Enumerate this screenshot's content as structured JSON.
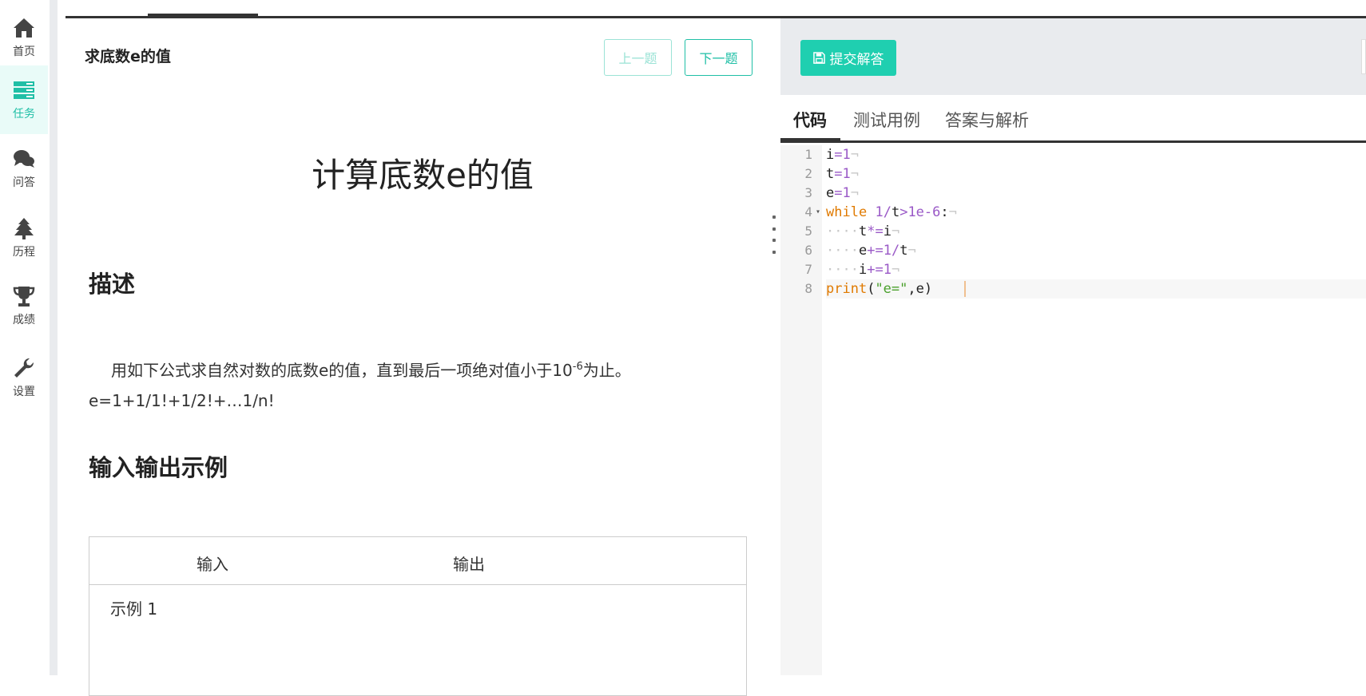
{
  "nav": {
    "items": [
      {
        "label": "首页",
        "icon": "home-icon"
      },
      {
        "label": "任务",
        "icon": "tasks-icon",
        "active": true
      },
      {
        "label": "问答",
        "icon": "chat-icon"
      },
      {
        "label": "历程",
        "icon": "tree-icon"
      },
      {
        "label": "成绩",
        "icon": "trophy-icon"
      },
      {
        "label": "设置",
        "icon": "wrench-icon"
      }
    ]
  },
  "problem": {
    "title": "求底数e的值",
    "prev_label": "上一题",
    "next_label": "下一题",
    "heading": "计算底数e的值",
    "desc_heading": "描述",
    "desc_text_a": "用如下公式求自然对数的底数e的值，直到最后一项绝对值小于10",
    "desc_sup": "-6",
    "desc_text_b": "为止。",
    "desc_formula": "e=1+1/1!+1/2!+…1/n!",
    "io_heading": "输入输出示例",
    "io_col_input": "输入",
    "io_col_output": "输出",
    "example_label": "示例 1"
  },
  "editor": {
    "submit_label": "提交解答",
    "tabs": [
      "代码",
      "测试用例",
      "答案与解析"
    ],
    "line_numbers": [
      "1",
      "2",
      "3",
      "4",
      "5",
      "6",
      "7",
      "8"
    ]
  },
  "colors": {
    "accent": "#1fcfb0",
    "active_nav": "#1fbfa6"
  }
}
